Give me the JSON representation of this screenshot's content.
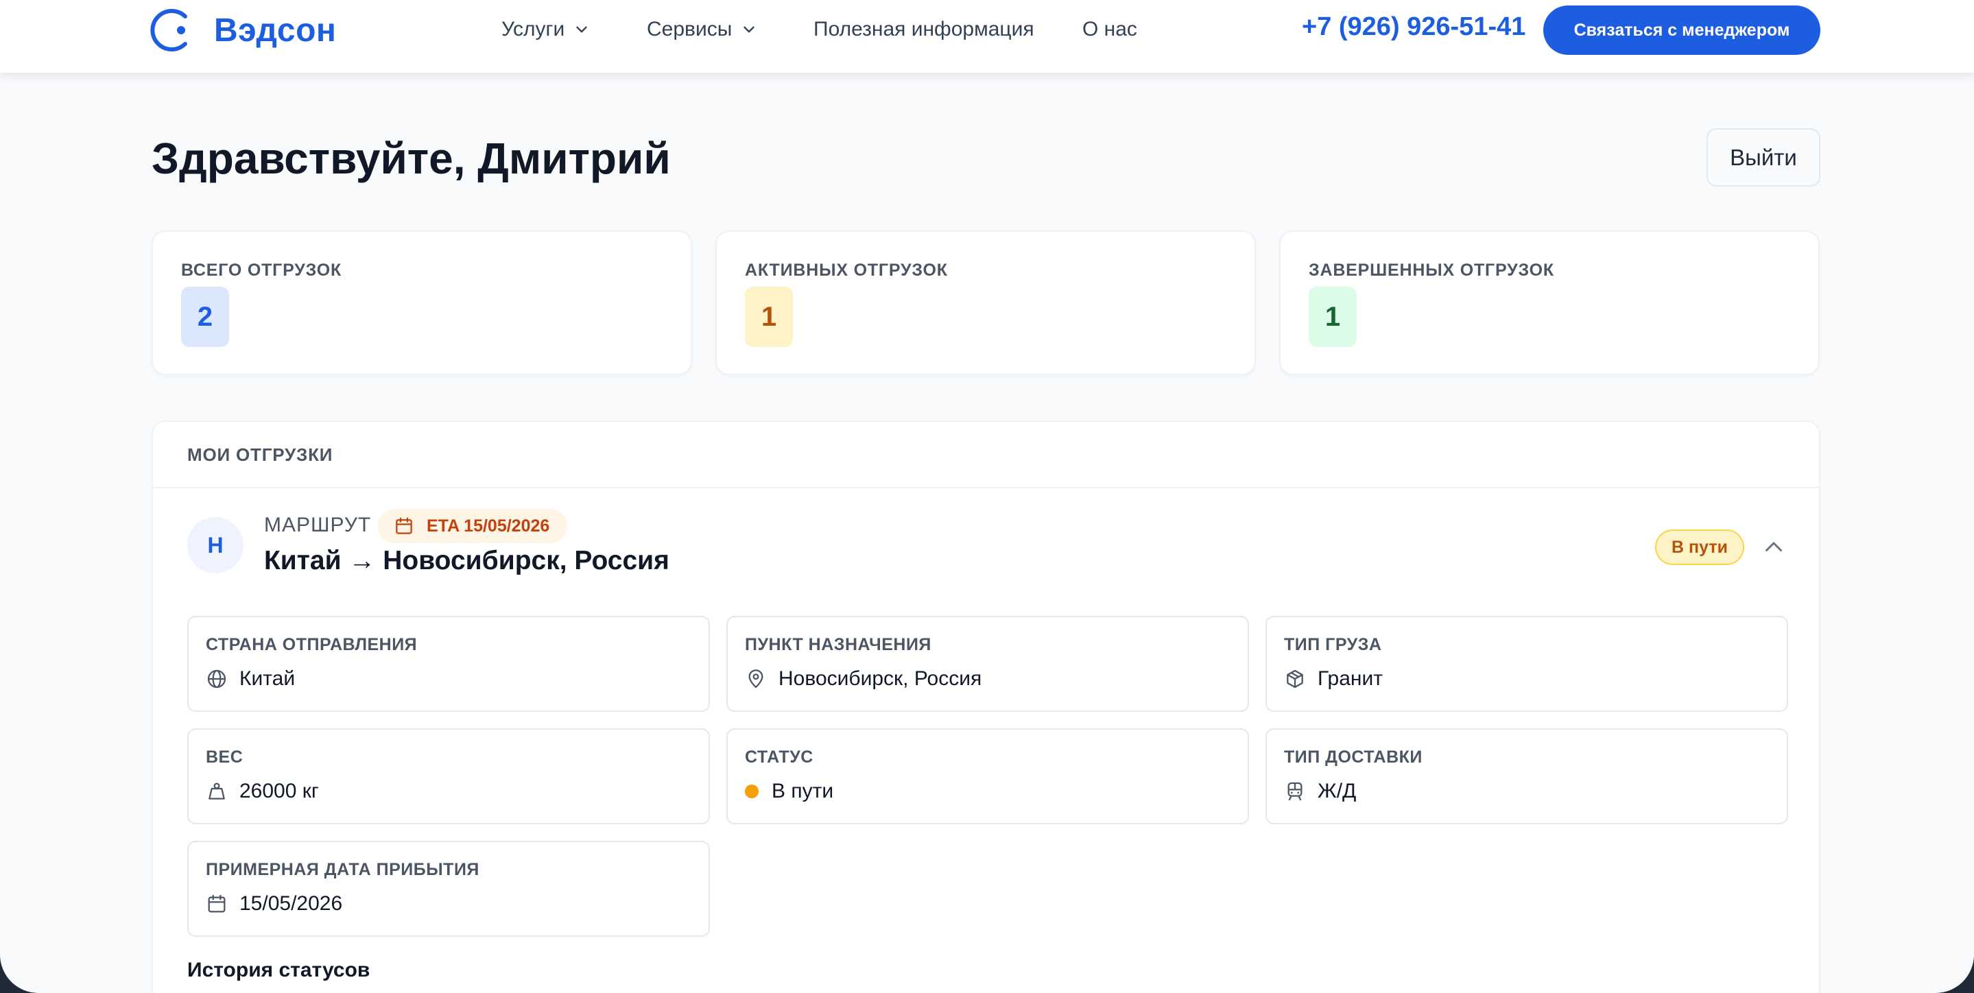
{
  "header": {
    "logo_text": "Вэдсон",
    "nav": [
      {
        "label": "Услуги",
        "has_dropdown": true
      },
      {
        "label": "Сервисы",
        "has_dropdown": true
      },
      {
        "label": "Полезная информация",
        "has_dropdown": false
      },
      {
        "label": "О нас",
        "has_dropdown": false
      }
    ],
    "phone": "+7 (926) 926-51-41",
    "cta_label": "Связаться с менеджером"
  },
  "greeting": "Здравствуйте, Дмитрий",
  "logout_label": "Выйти",
  "stats": [
    {
      "label": "ВСЕГО ОТГРУЗОК",
      "value": "2",
      "color": "#1d5ee0",
      "bg": "#dbe7fc"
    },
    {
      "label": "АКТИВНЫХ ОТГРУЗОК",
      "value": "1",
      "color": "#b45309",
      "bg": "#fef3c7"
    },
    {
      "label": "ЗАВЕРШЕННЫХ ОТГРУЗОК",
      "value": "1",
      "color": "#166534",
      "bg": "#dcfce7"
    }
  ],
  "shipments": {
    "title": "МОИ ОТГРУЗКИ",
    "item": {
      "avatar_letter": "Н",
      "route_label": "МАРШРУТ",
      "eta": "ETA 15/05/2026",
      "route": "Китай → Новосибирск, Россия",
      "status_badge": "В пути",
      "fields": [
        {
          "label": "СТРАНА ОТПРАВЛЕНИЯ",
          "value": "Китай",
          "icon": "globe-icon"
        },
        {
          "label": "ПУНКТ НАЗНАЧЕНИЯ",
          "value": "Новосибирск, Россия",
          "icon": "map-pin-icon"
        },
        {
          "label": "ТИП ГРУЗА",
          "value": "Гранит",
          "icon": "package-icon"
        },
        {
          "label": "ВЕС",
          "value": "26000 кг",
          "icon": "weight-icon"
        },
        {
          "label": "СТАТУС",
          "value": "В пути",
          "icon": "status-dot-icon"
        },
        {
          "label": "ТИП ДОСТАВКИ",
          "value": "Ж/Д",
          "icon": "train-icon"
        },
        {
          "label": "ПРИМЕРНАЯ ДАТА ПРИБЫТИЯ",
          "value": "15/05/2026",
          "icon": "calendar-icon"
        }
      ],
      "history_title": "История статусов"
    }
  },
  "colors": {
    "accent": "#1d5ee0",
    "status_in_transit": "#f59e0b",
    "eta_text": "#c2410c"
  }
}
